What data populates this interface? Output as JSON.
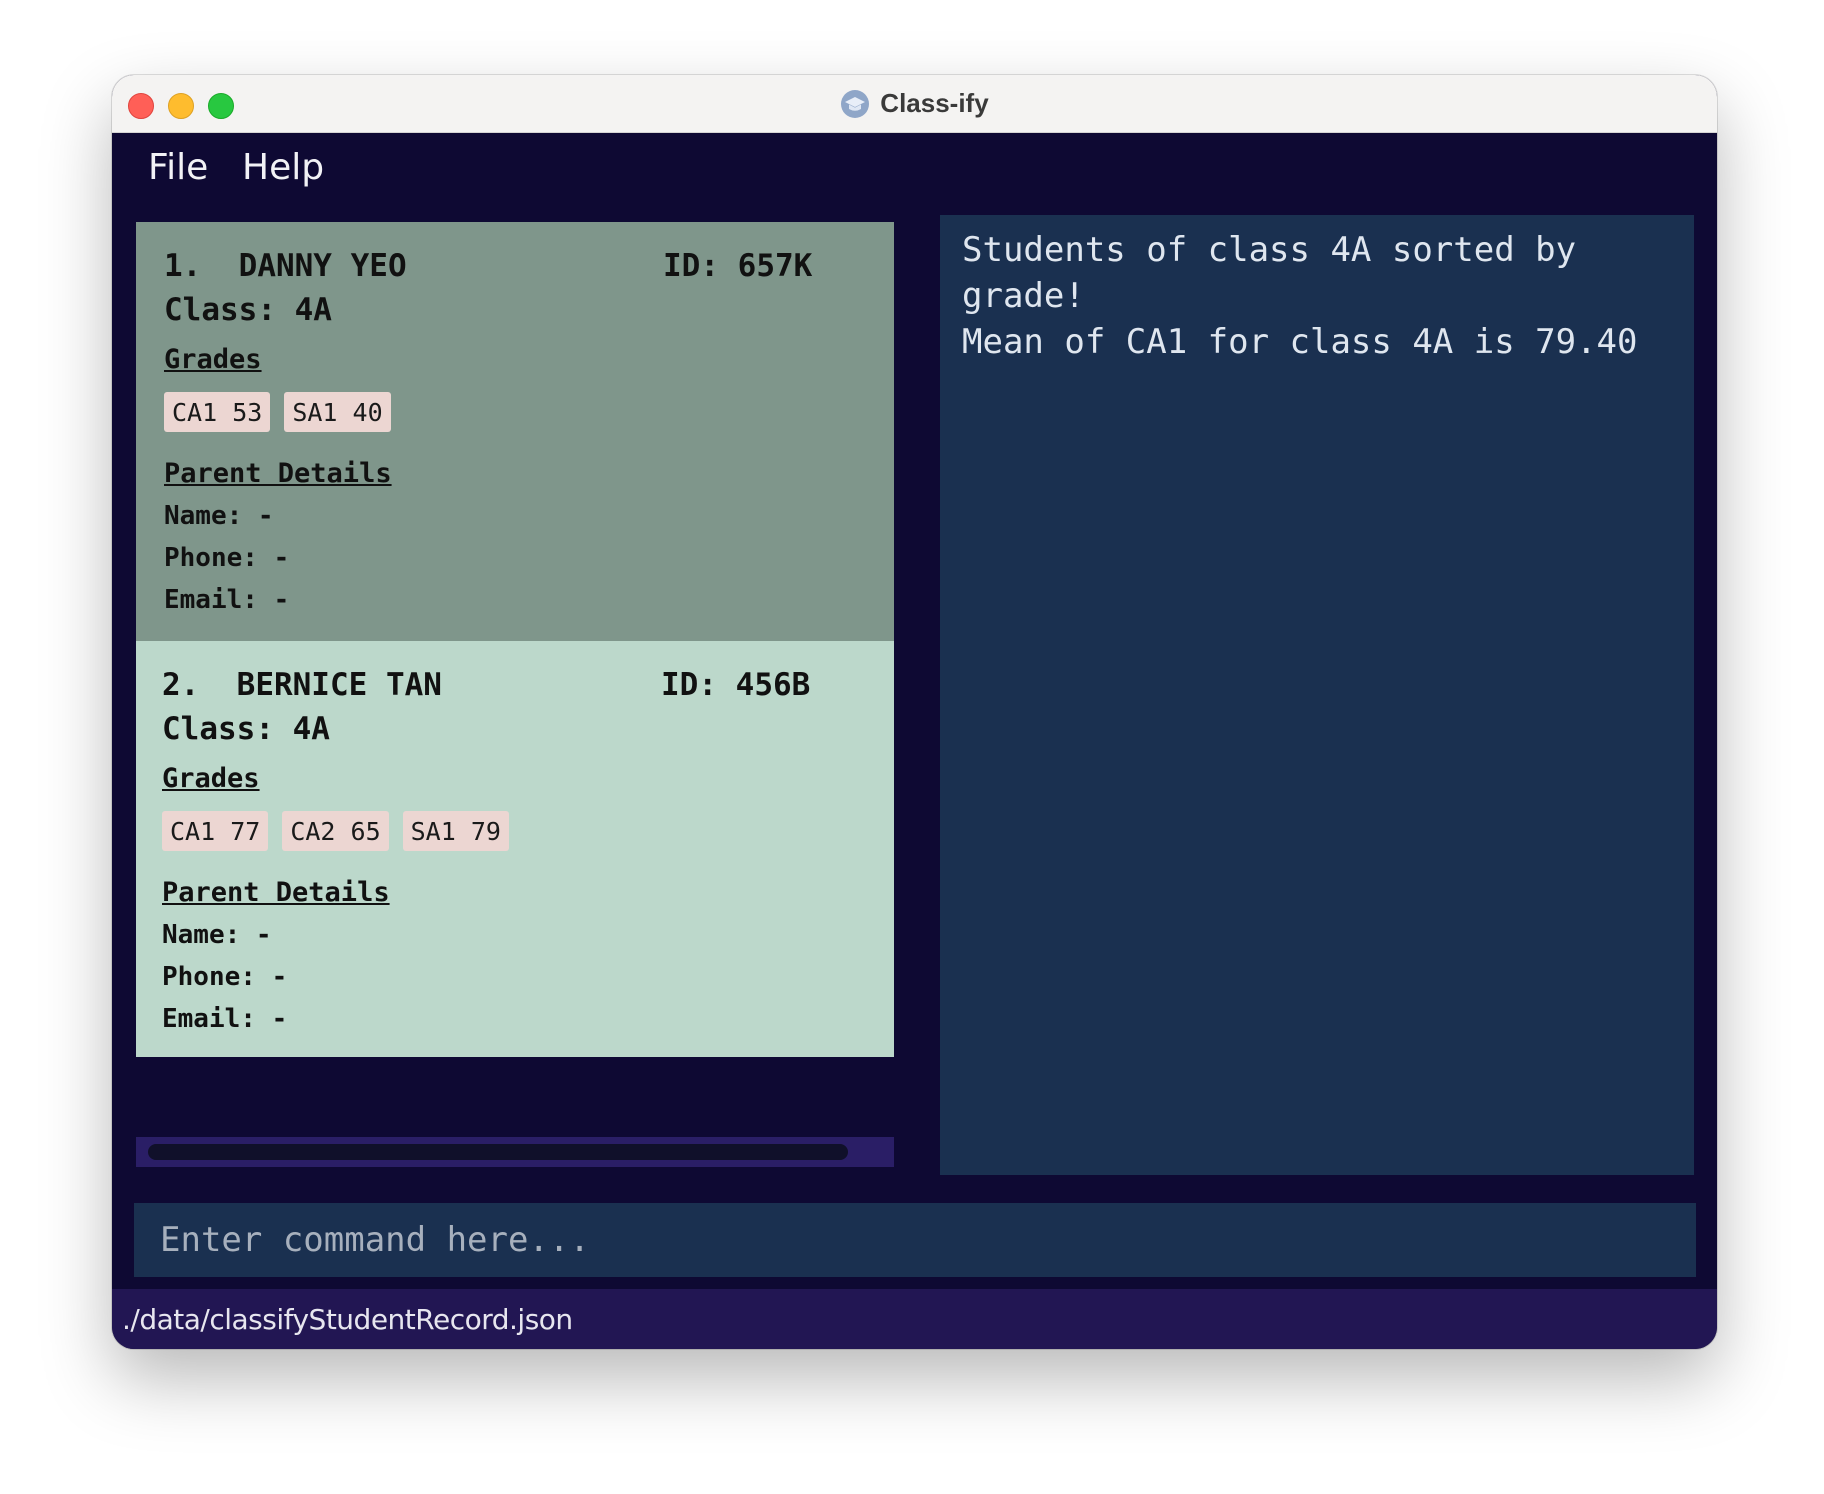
{
  "window": {
    "title": "Class-ify",
    "icon": "graduation-cap-icon"
  },
  "menu": {
    "items": [
      "File",
      "Help"
    ]
  },
  "students": [
    {
      "index_name": "1.  DANNY YEO",
      "id": "ID: 657K",
      "class": "Class: 4A",
      "grades_header": "Grades",
      "grades": [
        "CA1 53",
        "SA1 40"
      ],
      "parent_header": "Parent Details",
      "parent_name": "Name: -",
      "parent_phone": "Phone: -",
      "parent_email": "Email: -",
      "selected": true
    },
    {
      "index_name": "2.  BERNICE TAN",
      "id": "ID: 456B",
      "class": "Class: 4A",
      "grades_header": "Grades",
      "grades": [
        "CA1 77",
        "CA2 65",
        "SA1 79"
      ],
      "parent_header": "Parent Details",
      "parent_name": "Name: -",
      "parent_phone": "Phone: -",
      "parent_email": "Email: -",
      "selected": false
    }
  ],
  "result": {
    "text": "Students of class 4A sorted by grade!\nMean of CA1 for class 4A is 79.40"
  },
  "command": {
    "value": "",
    "placeholder": "Enter command here..."
  },
  "status": {
    "file_path": "./data/classifyStudentRecord.json"
  },
  "colors": {
    "window_bg": "#0e0933",
    "selected_card": "#7f968b",
    "card": "#bcd8cb",
    "tag": "#ecd6d2",
    "panel": "#1a3050",
    "status_bar": "#221653"
  }
}
